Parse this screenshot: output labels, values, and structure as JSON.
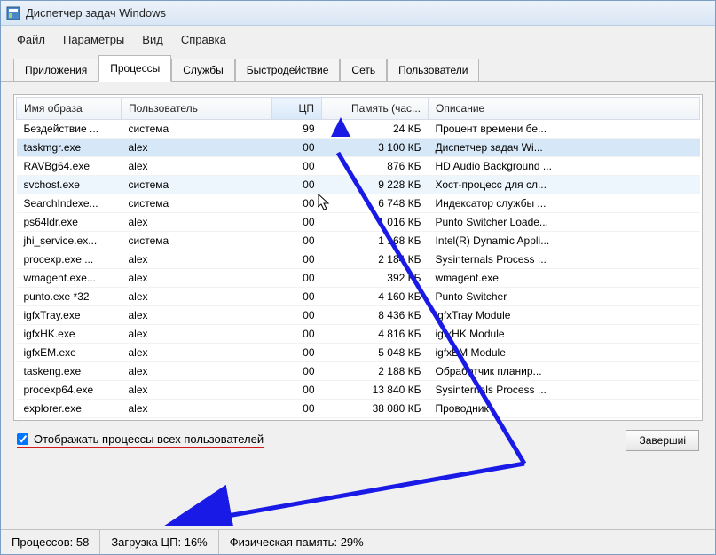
{
  "window": {
    "title": "Диспетчер задач Windows"
  },
  "menu": [
    "Файл",
    "Параметры",
    "Вид",
    "Справка"
  ],
  "tabs": {
    "items": [
      "Приложения",
      "Процессы",
      "Службы",
      "Быстродействие",
      "Сеть",
      "Пользователи"
    ],
    "active": 1
  },
  "columns": {
    "name": "Имя образа",
    "user": "Пользователь",
    "cpu": "ЦП",
    "mem": "Память (час...",
    "desc": "Описание"
  },
  "rows": [
    {
      "name": "Бездействие ...",
      "user": "система",
      "cpu": "99",
      "mem": "24 КБ",
      "desc": "Процент времени бе...",
      "state": ""
    },
    {
      "name": "taskmgr.exe",
      "user": "alex",
      "cpu": "00",
      "mem": "3 100 КБ",
      "desc": "Диспетчер задач Wi...",
      "state": "selected"
    },
    {
      "name": "RAVBg64.exe",
      "user": "alex",
      "cpu": "00",
      "mem": "876 КБ",
      "desc": "HD Audio Background ...",
      "state": ""
    },
    {
      "name": "svchost.exe",
      "user": "система",
      "cpu": "00",
      "mem": "9 228 КБ",
      "desc": "Хост-процесс для сл...",
      "state": "hover"
    },
    {
      "name": "SearchIndexe...",
      "user": "система",
      "cpu": "00",
      "mem": "6 748 КБ",
      "desc": "Индексатор службы ...",
      "state": ""
    },
    {
      "name": "ps64ldr.exe",
      "user": "alex",
      "cpu": "00",
      "mem": "1 016 КБ",
      "desc": "Punto Switcher Loade...",
      "state": ""
    },
    {
      "name": "jhi_service.ex...",
      "user": "система",
      "cpu": "00",
      "mem": "1 168 КБ",
      "desc": "Intel(R) Dynamic Appli...",
      "state": ""
    },
    {
      "name": "procexp.exe ...",
      "user": "alex",
      "cpu": "00",
      "mem": "2 184 КБ",
      "desc": "Sysinternals Process ...",
      "state": ""
    },
    {
      "name": "wmagent.exe...",
      "user": "alex",
      "cpu": "00",
      "mem": "392 КБ",
      "desc": "wmagent.exe",
      "state": ""
    },
    {
      "name": "punto.exe *32",
      "user": "alex",
      "cpu": "00",
      "mem": "4 160 КБ",
      "desc": "Punto Switcher",
      "state": ""
    },
    {
      "name": "igfxTray.exe",
      "user": "alex",
      "cpu": "00",
      "mem": "8 436 КБ",
      "desc": "igfxTray Module",
      "state": ""
    },
    {
      "name": "igfxHK.exe",
      "user": "alex",
      "cpu": "00",
      "mem": "4 816 КБ",
      "desc": "igfxHK Module",
      "state": ""
    },
    {
      "name": "igfxEM.exe",
      "user": "alex",
      "cpu": "00",
      "mem": "5 048 КБ",
      "desc": "igfxEM Module",
      "state": ""
    },
    {
      "name": "taskeng.exe",
      "user": "alex",
      "cpu": "00",
      "mem": "2 188 КБ",
      "desc": "Обработчик планир...",
      "state": ""
    },
    {
      "name": "procexp64.exe",
      "user": "alex",
      "cpu": "00",
      "mem": "13 840 КБ",
      "desc": "Sysinternals Process ...",
      "state": ""
    },
    {
      "name": "explorer.exe",
      "user": "alex",
      "cpu": "00",
      "mem": "38 080 КБ",
      "desc": "Проводник",
      "state": ""
    }
  ],
  "checkbox": {
    "label": "Отображать процессы всех пользователей",
    "checked": true
  },
  "button": {
    "end_process": "Завершиі"
  },
  "status": {
    "processes_label": "Процессов:",
    "processes": "58",
    "cpu_label": "Загрузка ЦП:",
    "cpu": "16%",
    "mem_label": "Физическая память:",
    "mem": "29%"
  }
}
